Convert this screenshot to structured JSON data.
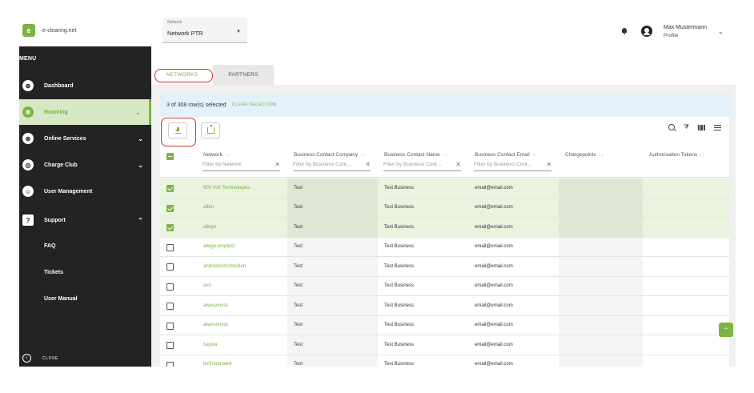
{
  "app": {
    "logo_mark": "e",
    "logo_text": "e-clearing.net"
  },
  "sidebar": {
    "menu_title": "MENU",
    "items": [
      {
        "label": "Dashboard",
        "icon": "dashboard-icon",
        "glyph": "⊕"
      },
      {
        "label": "Roaming",
        "icon": "roaming-icon",
        "glyph": "✲"
      },
      {
        "label": "Online Services",
        "icon": "online-services-icon",
        "glyph": "⊗"
      },
      {
        "label": "Charge Club",
        "icon": "charge-club-icon",
        "glyph": "◎"
      },
      {
        "label": "User Management",
        "icon": "user-management-icon",
        "glyph": "☺"
      },
      {
        "label": "Support",
        "icon": "support-icon",
        "glyph": "?"
      }
    ],
    "support_subitems": [
      "FAQ",
      "Tickets",
      "User Manual"
    ],
    "close_label": "CLOSE",
    "accent": "#7cb342"
  },
  "header": {
    "network_label": "Network",
    "network_value": "Network PTR",
    "user_name": "Max Mustermann",
    "user_role": "Profile"
  },
  "tabs": [
    "NETWORKS",
    "PARTNERS"
  ],
  "selection": {
    "text": "3 of 308 row(s) selected",
    "clear_label": "CLEAR SELECTION"
  },
  "table": {
    "columns": [
      {
        "label": "Network",
        "filter": "Filter by Network"
      },
      {
        "label": "Business Contact Company",
        "filter": "Filter by Business Cont..."
      },
      {
        "label": "Business Contact Name",
        "filter": "Filter by Business Cont..."
      },
      {
        "label": "Business Contact Email",
        "filter": "Filter by Business Cont..."
      },
      {
        "label": "Chargepoints",
        "filter": ""
      },
      {
        "label": "Authorisation Tokens",
        "filter": ""
      }
    ],
    "sort_glyph": "↑↓",
    "rows": [
      {
        "selected": true,
        "network": "800 Volt Technologies",
        "company": "Test",
        "name": "Test Business",
        "email": "email@email.com"
      },
      {
        "selected": true,
        "network": "alfen",
        "company": "Test",
        "name": "Test Business",
        "email": "email@email.com"
      },
      {
        "selected": true,
        "network": "allego",
        "company": "Test",
        "name": "Test Business",
        "email": "email@email.com"
      },
      {
        "selected": false,
        "network": "allego.emptest",
        "company": "Test",
        "name": "Test Business",
        "email": "email@email.com"
      },
      {
        "selected": false,
        "network": "andreloremzmedien",
        "company": "Test",
        "name": "Test Business",
        "email": "email@email.com"
      },
      {
        "selected": false,
        "network": "avd",
        "company": "Test",
        "name": "Test Business",
        "email": "email@email.com"
      },
      {
        "selected": false,
        "network": "awesomsss",
        "company": "Test",
        "name": "Test Business",
        "email": "email@email.com"
      },
      {
        "selected": false,
        "network": "awesomsss",
        "company": "Test",
        "name": "Test Business",
        "email": "email@email.com"
      },
      {
        "selected": false,
        "network": "baywa",
        "company": "Test",
        "name": "Test Business",
        "email": "email@email.com"
      },
      {
        "selected": false,
        "network": "beSnoprodell",
        "company": "Test",
        "name": "Test Business",
        "email": "email@email.com"
      }
    ]
  }
}
